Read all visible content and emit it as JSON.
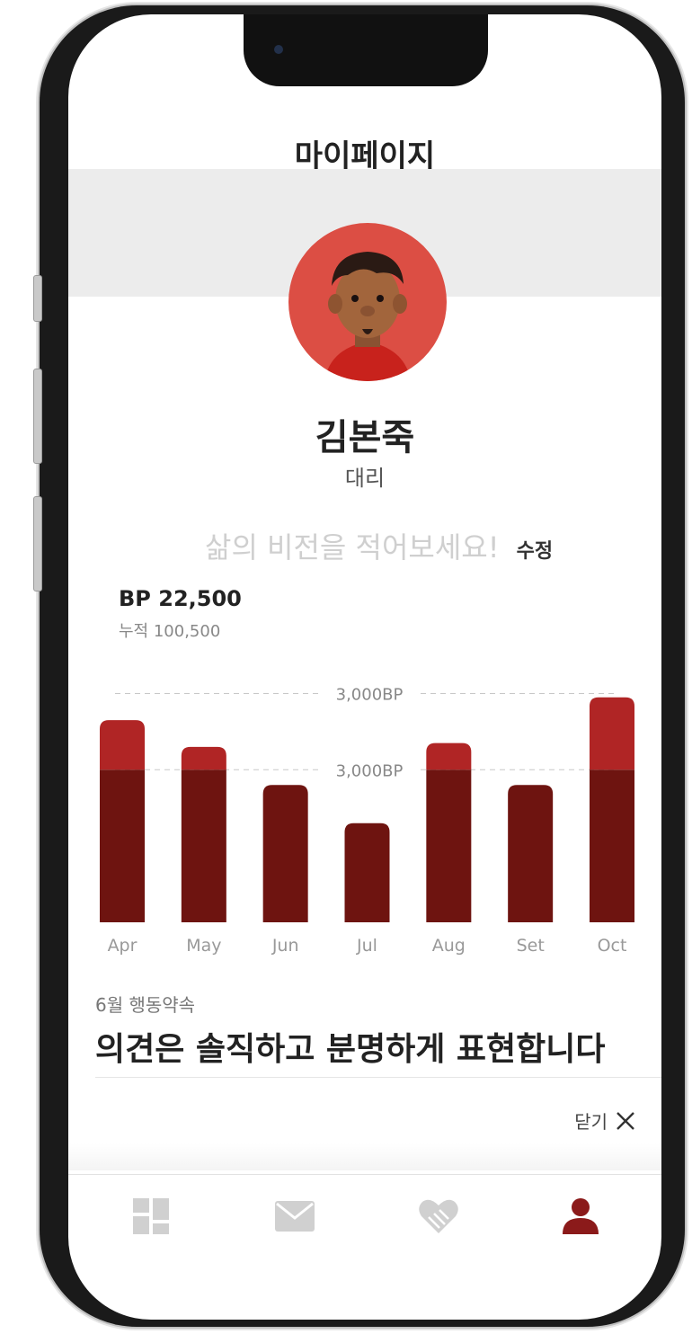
{
  "header": {
    "title": "마이페이지"
  },
  "profile": {
    "name": "김본죽",
    "role": "대리",
    "vision_placeholder": "삶의 비전을 적어보세요!",
    "edit_label": "수정"
  },
  "points": {
    "bp_label": "BP 22,500",
    "cumulative_label": "누적 100,500"
  },
  "chart_data": {
    "type": "bar",
    "categories": [
      "Apr",
      "May",
      "Jun",
      "Jul",
      "Aug",
      "Set",
      "Oct"
    ],
    "values": [
      2650,
      2300,
      1800,
      1300,
      2350,
      1800,
      2950
    ],
    "reference_lines": [
      {
        "value": 3000,
        "label": "3,000BP"
      },
      {
        "value": 2000,
        "label": "3,000BP"
      }
    ],
    "ylim": [
      0,
      3300
    ],
    "bar_color": "#8b1a1a",
    "bar_color_upper": "#b02525"
  },
  "promise": {
    "label": "6월 행동약속",
    "text": "의견은 솔직하고 분명하게 표현합니다",
    "close_label": "닫기"
  },
  "tabbar": {
    "items": [
      {
        "icon": "dashboard-icon",
        "active": false
      },
      {
        "icon": "mail-icon",
        "active": false
      },
      {
        "icon": "heart-hands-icon",
        "active": false
      },
      {
        "icon": "profile-icon",
        "active": true
      }
    ],
    "active_color": "#8b1a1a",
    "inactive_color": "#d0d0d0"
  }
}
